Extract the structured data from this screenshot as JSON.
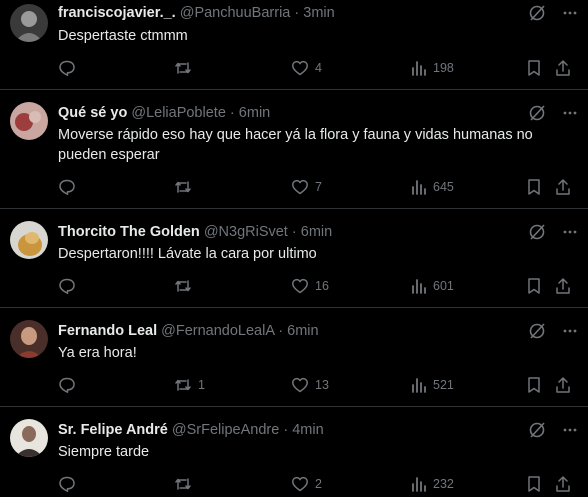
{
  "tweets": [
    {
      "name": "franciscojavier._.",
      "handle": "@PanchuuBarria",
      "sep": "·",
      "time": "3min",
      "text": "Despertaste ctmmm",
      "replies": "",
      "reposts": "",
      "likes": "4",
      "views": "198",
      "avatar_color": "#6b6b6b"
    },
    {
      "name": "Qué sé yo",
      "handle": "@LeliaPoblete",
      "sep": "·",
      "time": "6min",
      "text": "Moverse rápido eso hay que hacer yá la flora y fauna y vidas humanas no pueden esperar",
      "replies": "",
      "reposts": "",
      "likes": "7",
      "views": "645",
      "avatar_color": "#b56a6a"
    },
    {
      "name": "Thorcito The Golden",
      "handle": "@N3gRiSvet",
      "sep": "·",
      "time": "6min",
      "text": "Despertaron!!!! Lávate la cara por ultimo",
      "replies": "",
      "reposts": "",
      "likes": "16",
      "views": "601",
      "avatar_color": "#c8a46a"
    },
    {
      "name": "Fernando Leal",
      "handle": "@FernandoLealA",
      "sep": "·",
      "time": "6min",
      "text": "Ya era hora!",
      "replies": "",
      "reposts": "1",
      "likes": "13",
      "views": "521",
      "avatar_color": "#7a4a3a"
    },
    {
      "name": "Sr. Felipe André",
      "handle": "@SrFelipeAndre",
      "sep": "·",
      "time": "4min",
      "text": "Siempre tarde",
      "replies": "",
      "reposts": "",
      "likes": "2",
      "views": "232",
      "avatar_color": "#5a4a44"
    }
  ],
  "colors": {
    "background": "#000000",
    "text": "#e7e9ea",
    "muted": "#71767b",
    "divider": "#2f3336"
  }
}
